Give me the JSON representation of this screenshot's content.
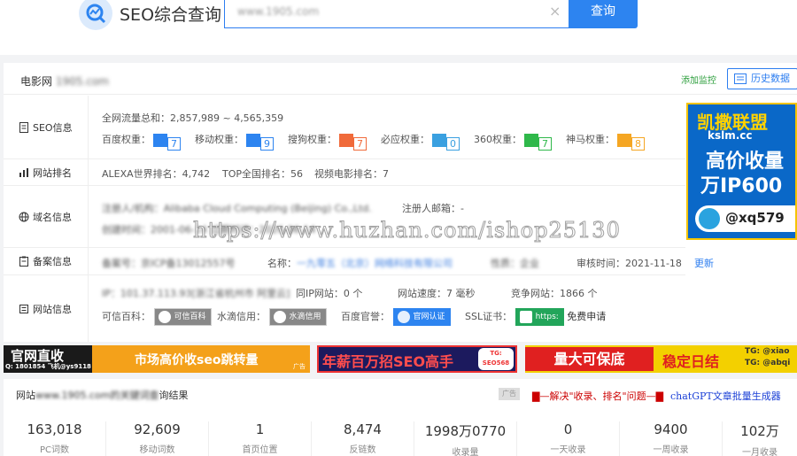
{
  "header": {
    "logo_text": "SEO综合查询",
    "search_value": "www.1905.com",
    "search_button": "查询"
  },
  "card": {
    "site_label": "电影网",
    "site_domain": "1905.com",
    "add_monitor": "添加监控",
    "history": "历史数据"
  },
  "seo": {
    "label": "SEO信息",
    "traffic": "全网流量总和：2,857,989 ~ 4,565,359",
    "weights": [
      {
        "name": "百度权重：",
        "value": "7",
        "color": "#2d84f0"
      },
      {
        "name": "移动权重：",
        "value": "9",
        "color": "#2d84f0"
      },
      {
        "name": "搜狗权重：",
        "value": "7",
        "color": "#f06a3a"
      },
      {
        "name": "必应权重：",
        "value": "0",
        "color": "#3aa0e0"
      },
      {
        "name": "360权重：",
        "value": "7",
        "color": "#2fb84a"
      },
      {
        "name": "神马权重：",
        "value": "8",
        "color": "#f5a623"
      }
    ]
  },
  "rank": {
    "label": "网站排名",
    "alexa": "ALEXA世界排名：4,742",
    "top": "TOP全国排名：56",
    "video": "视频电影排名：7"
  },
  "domain": {
    "label": "域名信息",
    "registrant": "注册人/机构：",
    "registrant_value": "Alibaba Cloud Computing (Beijing) Co.,Ltd.",
    "email": "注册人邮箱：-",
    "created_value": "创建时间：2001-06-14 过期时间：2026-06-14"
  },
  "beian": {
    "label": "备案信息",
    "no_value": "备案号：京ICP备13012557号",
    "name_label": "名称：",
    "name_value": "一九零五（北京）网络科技有限公司",
    "nature_value": "性质：企业",
    "audit": "审核时间：2021-11-18",
    "update": "更新"
  },
  "site": {
    "label": "网站信息",
    "ip_value": "IP：101.37.113.93[浙江省杭州市 阿里云]",
    "same_ip": "同IP网站：0 个",
    "speed": "网站速度：7 毫秒",
    "competitor": "竞争网站：1866 个",
    "kexin_label": "可信百科：",
    "kexin_chip": "可信百科",
    "shuidi_label": "水滴信用：",
    "shuidi_chip": "水滴信用",
    "baidu_label": "百度官誉：",
    "baidu_chip": "官网认证",
    "ssl_label": "SSL证书：",
    "ssl_chip": "https:",
    "ssl_free": "免费申请"
  },
  "side_ad": {
    "line1": "凯撒联盟",
    "line2": "kslm.cc",
    "line3": "高价收量",
    "line4": "万IP600",
    "tg": "@xq579"
  },
  "watermark": "https://www.huzhan.com/ishop25130",
  "banners": {
    "b1_left": "官网直收",
    "b1_sub": "Q: 1801854 飞机@ys9118",
    "b1_main": "市场高价收seo跳转量",
    "b1_tag": "广告",
    "b2_main": "年薪百万招SEO高手",
    "b2_tg": "TG:",
    "b2_tg2": "SEO568",
    "b3_a": "量大可保底",
    "b3_b": "稳定日结",
    "b3_c": "TG: @xiao",
    "b3_d": "TG: @abqi"
  },
  "stats": {
    "title_prefix": "网站",
    "title_blur": "www.1905.com的关键词查",
    "title_suffix": "询结果",
    "ad_tag": "广告",
    "link1": "▇—解决\"收录、排名\"问题—▇",
    "link2": "chatGPT文章批量生成器",
    "items": [
      {
        "value": "163,018",
        "label": "PC词数"
      },
      {
        "value": "92,609",
        "label": "移动词数"
      },
      {
        "value": "1",
        "label": "首页位置"
      },
      {
        "value": "8,474",
        "label": "反链数"
      },
      {
        "value": "1998万0770",
        "label": "收录量"
      },
      {
        "value": "0",
        "label": "一天收录"
      },
      {
        "value": "9400",
        "label": "一周收录"
      },
      {
        "value": "102万",
        "label": "一月收录"
      }
    ]
  }
}
